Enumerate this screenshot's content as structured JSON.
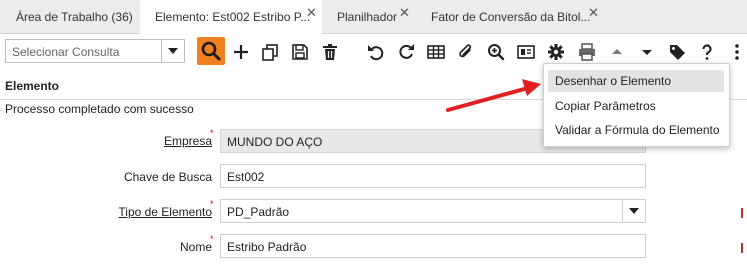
{
  "tabs": [
    {
      "label": "Área de Trabalho (36)",
      "closable": false,
      "active": false
    },
    {
      "label": "Elemento: Est002 Estribo P...",
      "closable": true,
      "active": true
    },
    {
      "label": "Planilhador",
      "closable": true,
      "active": false
    },
    {
      "label": "Fator de Conversão da Bitol...",
      "closable": true,
      "active": false
    }
  ],
  "toolbar": {
    "search_placeholder": "Selecionar Consulta",
    "icons": [
      "search-icon",
      "plus-icon",
      "copy-icon",
      "save-icon",
      "trash-icon",
      "undo-icon",
      "refresh-icon",
      "grid-icon",
      "attachment-icon",
      "zoom-icon",
      "report-icon",
      "gear-icon",
      "print-icon",
      "arrow-up-icon",
      "arrow-down-icon",
      "tag-icon",
      "help-icon",
      "more-icon"
    ],
    "accent_color": "#f08020"
  },
  "section": {
    "title": "Elemento",
    "status": "Processo completado com sucesso"
  },
  "form": {
    "fields": [
      {
        "label": "Empresa",
        "value": "MUNDO DO AÇO",
        "required": true,
        "link": true,
        "readonly": true
      },
      {
        "label": "Chave de Busca",
        "value": "Est002",
        "required": false,
        "link": false,
        "readonly": false
      },
      {
        "label": "Tipo de Elemento",
        "value": "PD_Padrão",
        "required": true,
        "link": true,
        "readonly": false,
        "dropdown": true
      },
      {
        "label": "Nome",
        "value": "Estribo Padrão",
        "required": true,
        "link": false,
        "readonly": false
      }
    ]
  },
  "menu": {
    "items": [
      {
        "label": "Desenhar o Elemento",
        "highlighted": true
      },
      {
        "label": "Copiar Parâmetros",
        "highlighted": false
      },
      {
        "label": "Validar a Fórmula do Elemento",
        "highlighted": false
      }
    ]
  },
  "annotation": {
    "type": "arrow",
    "color": "#e02020"
  }
}
